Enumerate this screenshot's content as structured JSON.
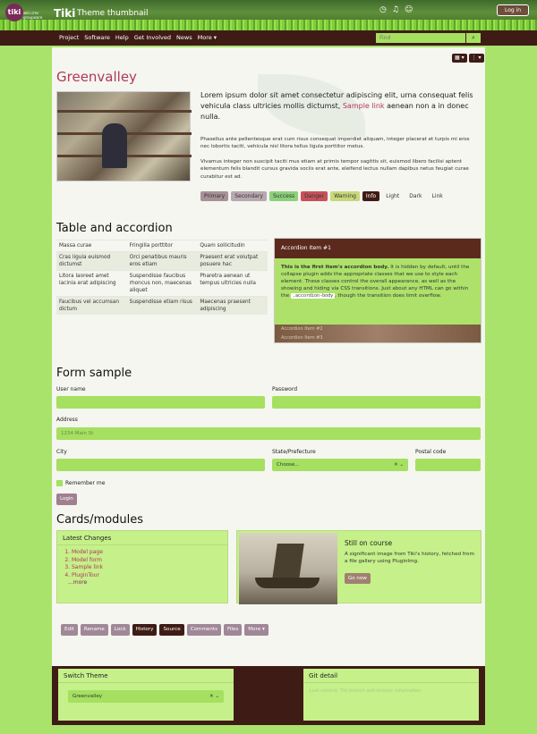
{
  "header": {
    "logo": "tiki",
    "logo_sub": "wiki cms groupware",
    "site_title": "Tiki",
    "page_subtitle": "Theme thumbnail",
    "icons": [
      "clock-icon",
      "bell-icon",
      "user-icon"
    ],
    "login_label": "Log in"
  },
  "nav": {
    "items": [
      "Project",
      "Software",
      "Help",
      "Get Involved",
      "News",
      "More ▾"
    ],
    "search_placeholder": "Find",
    "search_icon": "magnifier-icon"
  },
  "toolbar": {
    "grid_btn": "▦ ▾",
    "menu_btn": "⋮ ▾"
  },
  "hero": {
    "title": "Greenvalley",
    "lead_before": "Lorem ipsum dolor sit amet consectetur adipiscing elit, urna consequat felis vehicula class ultricies mollis dictumst, ",
    "lead_link": "Sample link",
    "lead_after": " aenean non a in donec nulla.",
    "p1": "Phasellus ante pellentesque erat cum risus consequat imperdiet aliquam, integer placerat et turpis mi eros nec lobortis taciti, vehicula nisl litora tellus ligula porttitor metus.",
    "p2": "Vivamus integer non suscipit taciti mus etiam at primis tempor sagittis sit, euismod libero facilisi aptent elementum felis blandit cursus gravida sociis erat ante, eleifend lectus nullam dapibus netus feugiat curae curabitur est ad.",
    "buttons": [
      {
        "label": "Primary",
        "bg": "#a89098"
      },
      {
        "label": "Secondary",
        "bg": "#b8a8b0"
      },
      {
        "label": "Success",
        "bg": "#8cd07a"
      },
      {
        "label": "Danger",
        "bg": "#c8505a"
      },
      {
        "label": "Warning",
        "bg": "#c8d87a"
      },
      {
        "label": "Info",
        "bg": "#3e1c15"
      },
      {
        "label": "Light",
        "bg": "#f4f6ef"
      },
      {
        "label": "Dark",
        "bg": "#f4f6ef"
      },
      {
        "label": "Link",
        "bg": "#f4f6ef"
      }
    ]
  },
  "table_section": {
    "title": "Table and accordion",
    "rows": [
      [
        "Massa curae",
        "Fringilla porttitor",
        "Quam sollicitudin"
      ],
      [
        "Cras ligula euismod dictumst",
        "Orci penatibus mauris eros etiam",
        "Praesent erat volutpat posuere hac"
      ],
      [
        "Litora laoreet amet lacinia erat adipiscing",
        "Suspendisse faucibus rhoncus non, maecenas aliquet",
        "Pharetra aenean ut tempus ultricies nulla"
      ],
      [
        "Faucibus vel accumsan dictum",
        "Suspendisse etiam risus",
        "Maecenas praesent adipiscing"
      ]
    ],
    "accordion": {
      "header": "Accordion Item #1",
      "body_strong": "This is the first item's accordion body.",
      "body_text": " It is hidden by default, until the collapse plugin adds the appropriate classes that we use to style each element. These classes control the overall appearance, as well as the showing and hiding via CSS transitions. Just about any HTML can go within the ",
      "body_code": ".accordion-body",
      "body_end": ", though the transition does limit overflow.",
      "item2": "Accordion Item #2",
      "item3": "Accordion Item #3"
    }
  },
  "form": {
    "title": "Form sample",
    "username_label": "User name",
    "password_label": "Password",
    "address_label": "Address",
    "address_placeholder": "1234 Main St",
    "city_label": "City",
    "state_label": "State/Prefecture",
    "state_value": "Choose...",
    "postal_label": "Postal code",
    "remember": "Remember me",
    "login_btn": "Login"
  },
  "cards": {
    "title": "Cards/modules",
    "latest_title": "Latest Changes",
    "latest_items": [
      "Model page",
      "Model form",
      "Sample link",
      "PluginTour"
    ],
    "latest_more": "...more",
    "card_title": "Still on course",
    "card_text": "A significant image from Tiki's history, fetched from a file gallery using PluginImg.",
    "card_btn": "Go now"
  },
  "page_buttons": [
    "Edit",
    "Rename",
    "Lock",
    "History",
    "Source",
    "Comments",
    "Files",
    "More ▾"
  ],
  "footer": {
    "switch_title": "Switch Theme",
    "theme_value": "Greenvalley",
    "git_title": "Git detail",
    "git_text": "Last commit: Tiki branch and revision information"
  }
}
